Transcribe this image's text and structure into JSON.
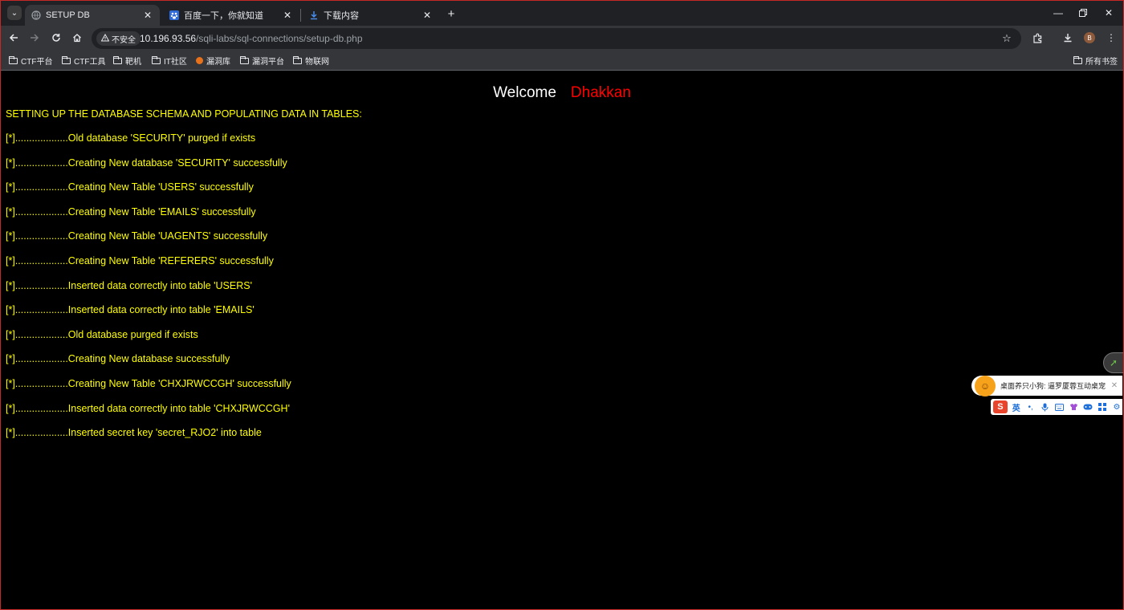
{
  "tabs": [
    {
      "title": "SETUP DB",
      "favicon": "globe-icon",
      "active": true
    },
    {
      "title": "百度一下，你就知道",
      "favicon": "baidu-icon",
      "active": false
    },
    {
      "title": "下载内容",
      "favicon": "download-icon",
      "active": false
    }
  ],
  "toolbar": {
    "security_label": "不安全",
    "url_host": "10.196.93.56",
    "url_path": "/sqli-labs/sql-connections/setup-db.php",
    "avatar_initial": "B"
  },
  "bookmarks": {
    "items": [
      {
        "label": "CTF平台",
        "icon": "folder-icon"
      },
      {
        "label": "CTF工具",
        "icon": "folder-icon"
      },
      {
        "label": "靶机",
        "icon": "folder-icon"
      },
      {
        "label": "IT社区",
        "icon": "folder-icon"
      },
      {
        "label": "漏洞库",
        "icon": "site-icon"
      },
      {
        "label": "漏洞平台",
        "icon": "folder-icon"
      },
      {
        "label": "物联网",
        "icon": "folder-icon"
      }
    ],
    "all_bookmarks": "所有书签"
  },
  "page": {
    "welcome": "Welcome",
    "name": "Dhakkan",
    "heading": "SETTING UP THE DATABASE SCHEMA AND POPULATING DATA IN TABLES:",
    "lines": [
      "[*]...................Old database 'SECURITY' purged if exists",
      "[*]...................Creating New database 'SECURITY' successfully",
      "[*]...................Creating New Table 'USERS' successfully",
      "[*]...................Creating New Table 'EMAILS' successfully",
      "[*]...................Creating New Table 'UAGENTS' successfully",
      "[*]...................Creating New Table 'REFERERS' successfully",
      "[*]...................Inserted data correctly into table 'USERS'",
      "[*]...................Inserted data correctly into table 'EMAILS'",
      "[*]...................Old database purged if exists",
      "[*]...................Creating New database successfully",
      "[*]...................Creating New Table 'CHXJRWCCGH' successfully",
      "[*]...................Inserted data correctly into table 'CHXJRWCCGH'",
      "[*]...................Inserted secret key 'secret_RJO2' into table"
    ]
  },
  "widgets": {
    "pet_text": "桌面养只小狗: 逼罗厦蓉互动桌宠",
    "ime_lang": "英"
  },
  "colors": {
    "page_bg": "#000000",
    "log_text": "#ffff00",
    "welcome_text": "#ffffff",
    "name_text": "#ff0000",
    "frame": "#c62828"
  }
}
